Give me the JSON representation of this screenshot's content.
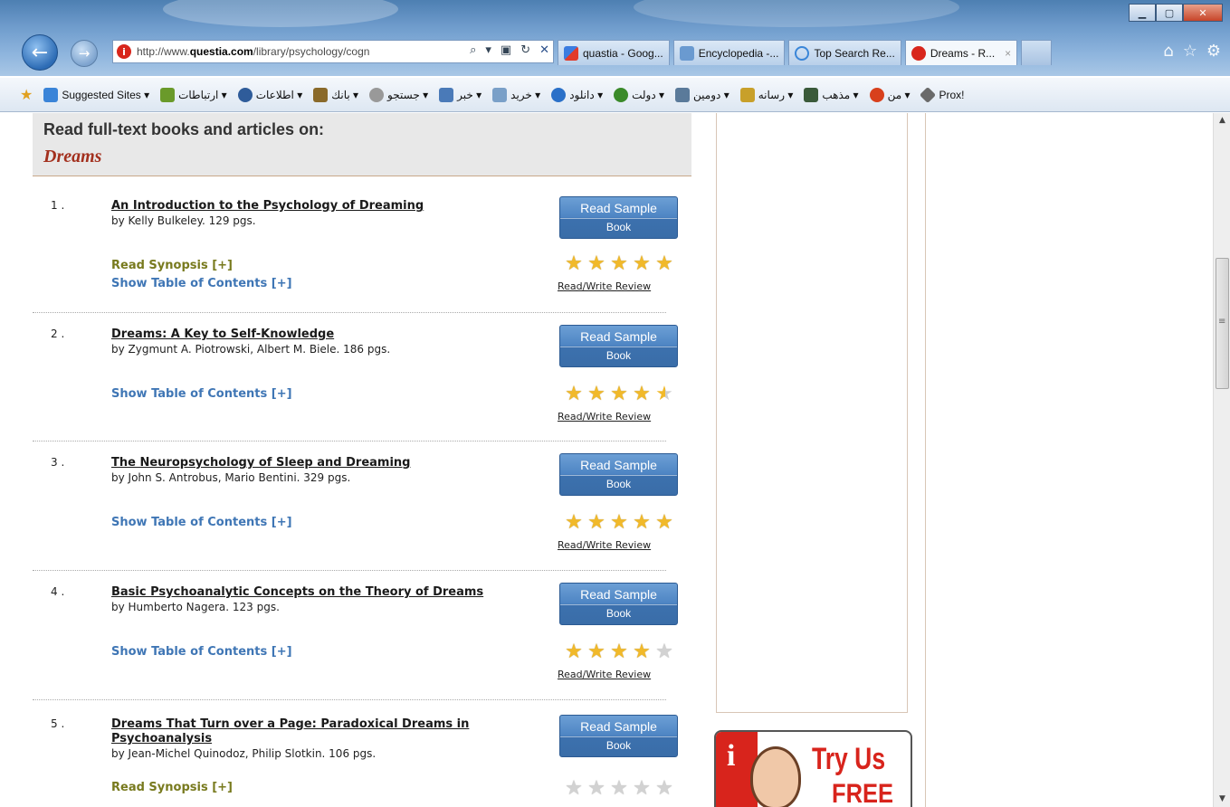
{
  "browser": {
    "url_prefix": "http://www.",
    "url_domain": "questia.com",
    "url_path": "/library/psychology/cogn",
    "tabs": [
      {
        "label": "quastia - Goog...",
        "icon": "google-icon",
        "active": false
      },
      {
        "label": "Encyclopedia -...",
        "icon": "encyclopedia-icon",
        "active": false
      },
      {
        "label": "Top Search Re...",
        "icon": "ie-icon",
        "active": false
      },
      {
        "label": "Dreams - R...",
        "icon": "info-icon",
        "active": true
      }
    ],
    "close_tab": "×"
  },
  "favorites": [
    {
      "label": "Suggested Sites ▾",
      "icon": "ie-suggested-icon",
      "color": "#3a84d8"
    },
    {
      "label": "ارتباطات ▾",
      "icon": "network-icon",
      "color": "#6a9a2a"
    },
    {
      "label": "اطلاعات ▾",
      "icon": "question-icon",
      "color": "#2f5c9a"
    },
    {
      "label": "بانك ▾",
      "icon": "bank-icon",
      "color": "#8a6a2a"
    },
    {
      "label": "جستجو ▾",
      "icon": "search-icon",
      "color": "#666666"
    },
    {
      "label": "خبر ▾",
      "icon": "news-icon",
      "color": "#4a7ab8"
    },
    {
      "label": "خريد ▾",
      "icon": "shop-icon",
      "color": "#7aa0c8"
    },
    {
      "label": "دانلود ▾",
      "icon": "download-icon",
      "color": "#2a70c8"
    },
    {
      "label": "دولت ▾",
      "icon": "tree-icon",
      "color": "#3a8a2a"
    },
    {
      "label": "دومين ▾",
      "icon": "domain-icon",
      "color": "#5a7a9a"
    },
    {
      "label": "رسانه ▾",
      "icon": "media-icon",
      "color": "#c8a02a"
    },
    {
      "label": "مذهب ▾",
      "icon": "religion-icon",
      "color": "#3a5a3a"
    },
    {
      "label": "من ▾",
      "icon": "person-icon",
      "color": "#d8401c"
    },
    {
      "label": "Prox!",
      "icon": "proxy-icon",
      "color": "#6a6a6a"
    }
  ],
  "header": {
    "title": "Read full-text books and articles on:",
    "topic": "Dreams"
  },
  "results": [
    {
      "num": "1 .",
      "title": "An Introduction to the Psychology of Dreaming",
      "byline": "by Kelly Bulkeley. 129 pgs.",
      "synopsis": "Read Synopsis [+]",
      "toc": "Show Table of Contents [+]",
      "button_l1": "Read Sample",
      "button_l2": "Book",
      "rating": 5,
      "review": "Read/Write Review"
    },
    {
      "num": "2 .",
      "title": "Dreams: A Key to Self-Knowledge",
      "byline": "by Zygmunt A. Piotrowski, Albert M. Biele. 186 pgs.",
      "synopsis": "",
      "toc": "Show Table of Contents [+]",
      "button_l1": "Read Sample",
      "button_l2": "Book",
      "rating": 4.5,
      "review": "Read/Write Review"
    },
    {
      "num": "3 .",
      "title": "The Neuropsychology of Sleep and Dreaming",
      "byline": "by John S. Antrobus, Mario Bentini. 329 pgs.",
      "synopsis": "",
      "toc": "Show Table of Contents [+]",
      "button_l1": "Read Sample",
      "button_l2": "Book",
      "rating": 5,
      "review": "Read/Write Review"
    },
    {
      "num": "4 .",
      "title": "Basic Psychoanalytic Concepts on the Theory of Dreams",
      "byline": "by Humberto Nagera. 123 pgs.",
      "synopsis": "",
      "toc": "Show Table of Contents [+]",
      "button_l1": "Read Sample",
      "button_l2": "Book",
      "rating": 4,
      "review": "Read/Write Review"
    },
    {
      "num": "5 .",
      "title": "Dreams That Turn over a Page: Paradoxical Dreams in Psychoanalysis",
      "byline": "by Jean-Michel Quinodoz, Philip Slotkin. 106 pgs.",
      "synopsis": "Read Synopsis [+]",
      "toc": "",
      "button_l1": "Read Sample",
      "button_l2": "Book",
      "rating": 0,
      "review": ""
    }
  ],
  "ad": {
    "badge": "i",
    "line1": "Try Us",
    "line2": "FREE"
  }
}
